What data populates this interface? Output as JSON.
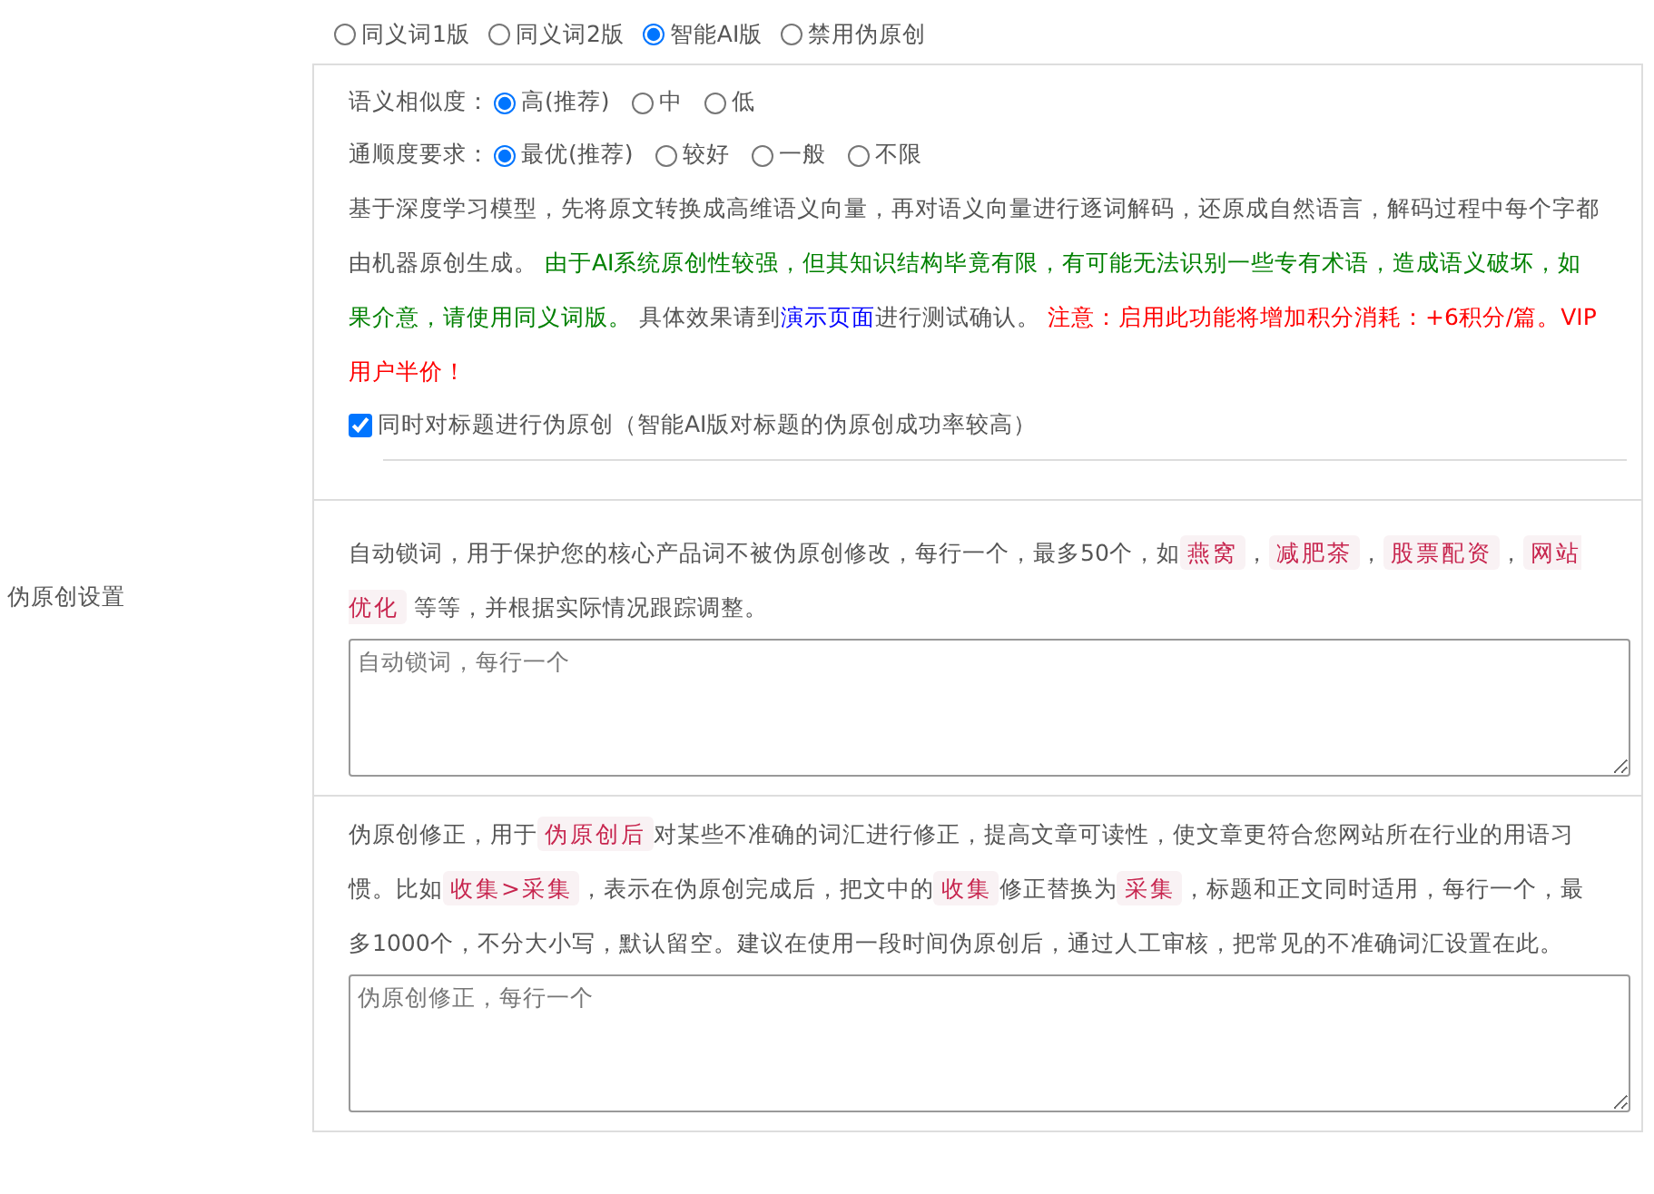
{
  "section_label": "伪原创设置",
  "modes": [
    {
      "label": "同义词1版",
      "selected": false
    },
    {
      "label": "同义词2版",
      "selected": false
    },
    {
      "label": "智能AI版",
      "selected": true
    },
    {
      "label": "禁用伪原创",
      "selected": false
    }
  ],
  "ai_options": [
    {
      "label": "语义相似度：",
      "options": [
        {
          "label": "高(推荐)",
          "selected": true
        },
        {
          "label": "中",
          "selected": false
        },
        {
          "label": "低",
          "selected": false
        }
      ]
    },
    {
      "label": "通顺度要求：",
      "options": [
        {
          "label": "最优(推荐)",
          "selected": true
        },
        {
          "label": "较好",
          "selected": false
        },
        {
          "label": "一般",
          "selected": false
        },
        {
          "label": "不限",
          "selected": false
        }
      ]
    }
  ],
  "ai_description": [
    {
      "kind": "plain",
      "text": "基于深度学习模型，先将原文转换成高维语义向量，再对语义向量进行逐词解码，还原成自然语言，解码过程中每个字都由机器原创生成。 "
    },
    {
      "kind": "green",
      "text": "由于AI系统原创性较强，但其知识结构毕竟有限，有可能无法识别一些专有术语，造成语义破坏，如果介意，请使用同义词版。"
    },
    {
      "kind": "plain",
      "text": " 具体效果请到"
    },
    {
      "kind": "link",
      "text": "演示页面"
    },
    {
      "kind": "plain",
      "text": "进行测试确认。 "
    },
    {
      "kind": "red",
      "text": "注意：启用此功能将增加积分消耗：+6积分/篇。VIP用户半价！"
    }
  ],
  "title_rewrite": {
    "label": "同时对标题进行伪原创（智能AI版对标题的伪原创成功率较高）",
    "checked": true
  },
  "lock_words": {
    "description": [
      {
        "kind": "plain",
        "text": "自动锁词，用于保护您的核心产品词不被伪原创修改，每行一个，最多50个，如"
      },
      {
        "kind": "tag",
        "text": "燕窝"
      },
      {
        "kind": "plain",
        "text": "，"
      },
      {
        "kind": "tag",
        "text": "减肥茶"
      },
      {
        "kind": "plain",
        "text": "，"
      },
      {
        "kind": "tag",
        "text": "股票配资"
      },
      {
        "kind": "plain",
        "text": "，"
      },
      {
        "kind": "tag",
        "text": "网站优化"
      },
      {
        "kind": "plain",
        "text": " 等等，并根据实际情况跟踪调整。"
      }
    ],
    "placeholder": "自动锁词，每行一个"
  },
  "corrections": {
    "description": [
      {
        "kind": "plain",
        "text": "伪原创修正，用于"
      },
      {
        "kind": "tag",
        "text": "伪原创后"
      },
      {
        "kind": "plain",
        "text": "对某些不准确的词汇进行修正，提高文章可读性，使文章更符合您网站所在行业的用语习惯。比如"
      },
      {
        "kind": "tag",
        "text": "收集>采集"
      },
      {
        "kind": "plain",
        "text": "，表示在伪原创完成后，把文中的"
      },
      {
        "kind": "tag",
        "text": "收集"
      },
      {
        "kind": "plain",
        "text": "修正替换为"
      },
      {
        "kind": "tag",
        "text": "采集"
      },
      {
        "kind": "plain",
        "text": "，标题和正文同时适用，每行一个，最多1000个，不分大小写，默认留空。建议在使用一段时间伪原创后，通过人工审核，把常见的不准确词汇设置在此。"
      }
    ],
    "placeholder": "伪原创修正，每行一个"
  }
}
